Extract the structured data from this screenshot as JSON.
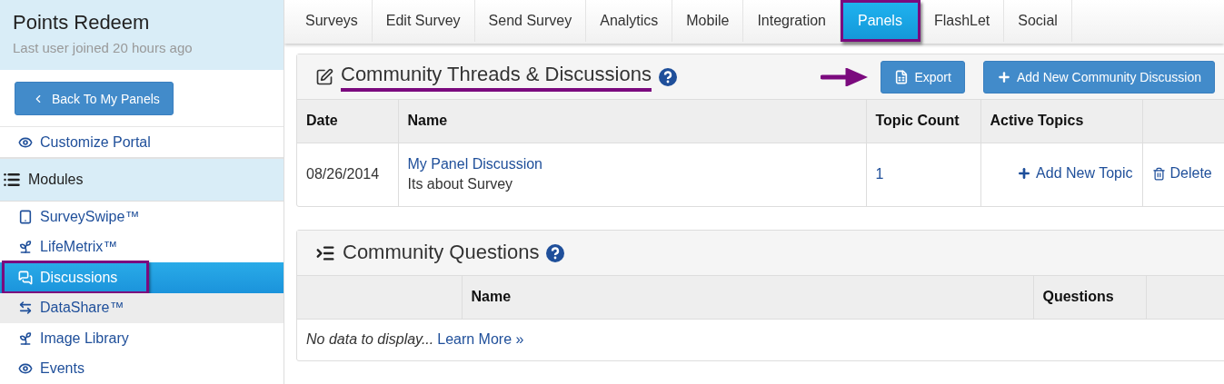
{
  "sidebar": {
    "title": "Points Redeem",
    "subtitle": "Last user joined 20 hours ago",
    "back_button": "Back To My Panels",
    "portal_link": {
      "label": "Customize Portal"
    },
    "section": {
      "label": "Modules"
    },
    "items": [
      {
        "label": "SurveySwipe™",
        "kind": "mobile",
        "selected": false,
        "hovered": false,
        "annotated": false
      },
      {
        "label": "LifeMetrix™",
        "kind": "module",
        "selected": false,
        "hovered": false,
        "annotated": false
      },
      {
        "label": "Discussions",
        "kind": "discussion",
        "selected": true,
        "hovered": false,
        "annotated": true
      },
      {
        "label": "DataShare™",
        "kind": "share",
        "selected": false,
        "hovered": true,
        "annotated": false
      },
      {
        "label": "Image Library",
        "kind": "module",
        "selected": false,
        "hovered": false,
        "annotated": false
      },
      {
        "label": "Events",
        "kind": "view",
        "selected": false,
        "hovered": false,
        "annotated": false
      }
    ]
  },
  "tabs": [
    {
      "label": "Surveys",
      "selected": false,
      "annotated": false
    },
    {
      "label": "Edit Survey",
      "selected": false,
      "annotated": false
    },
    {
      "label": "Send Survey",
      "selected": false,
      "annotated": false
    },
    {
      "label": "Analytics",
      "selected": false,
      "annotated": false
    },
    {
      "label": "Mobile",
      "selected": false,
      "annotated": false
    },
    {
      "label": "Integration",
      "selected": false,
      "annotated": false
    },
    {
      "label": "Panels",
      "selected": true,
      "annotated": true
    },
    {
      "label": "FlashLet",
      "selected": false,
      "annotated": false
    },
    {
      "label": "Social",
      "selected": false,
      "annotated": false
    }
  ],
  "threads_panel": {
    "title": "Community Threads & Discussions",
    "underlined": true,
    "export_button": {
      "label": "Export",
      "pointed": true
    },
    "add_button": {
      "label": "Add New Community Discussion"
    },
    "columns": [
      "Date",
      "Name",
      "Topic Count",
      "Active Topics"
    ],
    "rows": [
      {
        "date": "08/26/2014",
        "name": "My Panel Discussion",
        "description": "Its about Survey",
        "topic_count": "1",
        "add_topic": "Add New Topic",
        "delete": "Delete"
      }
    ]
  },
  "questions_panel": {
    "title": "Community Questions",
    "columns": [
      "Name",
      "Questions"
    ],
    "empty_text": "No data to display...",
    "learn_more": "Learn More »"
  }
}
